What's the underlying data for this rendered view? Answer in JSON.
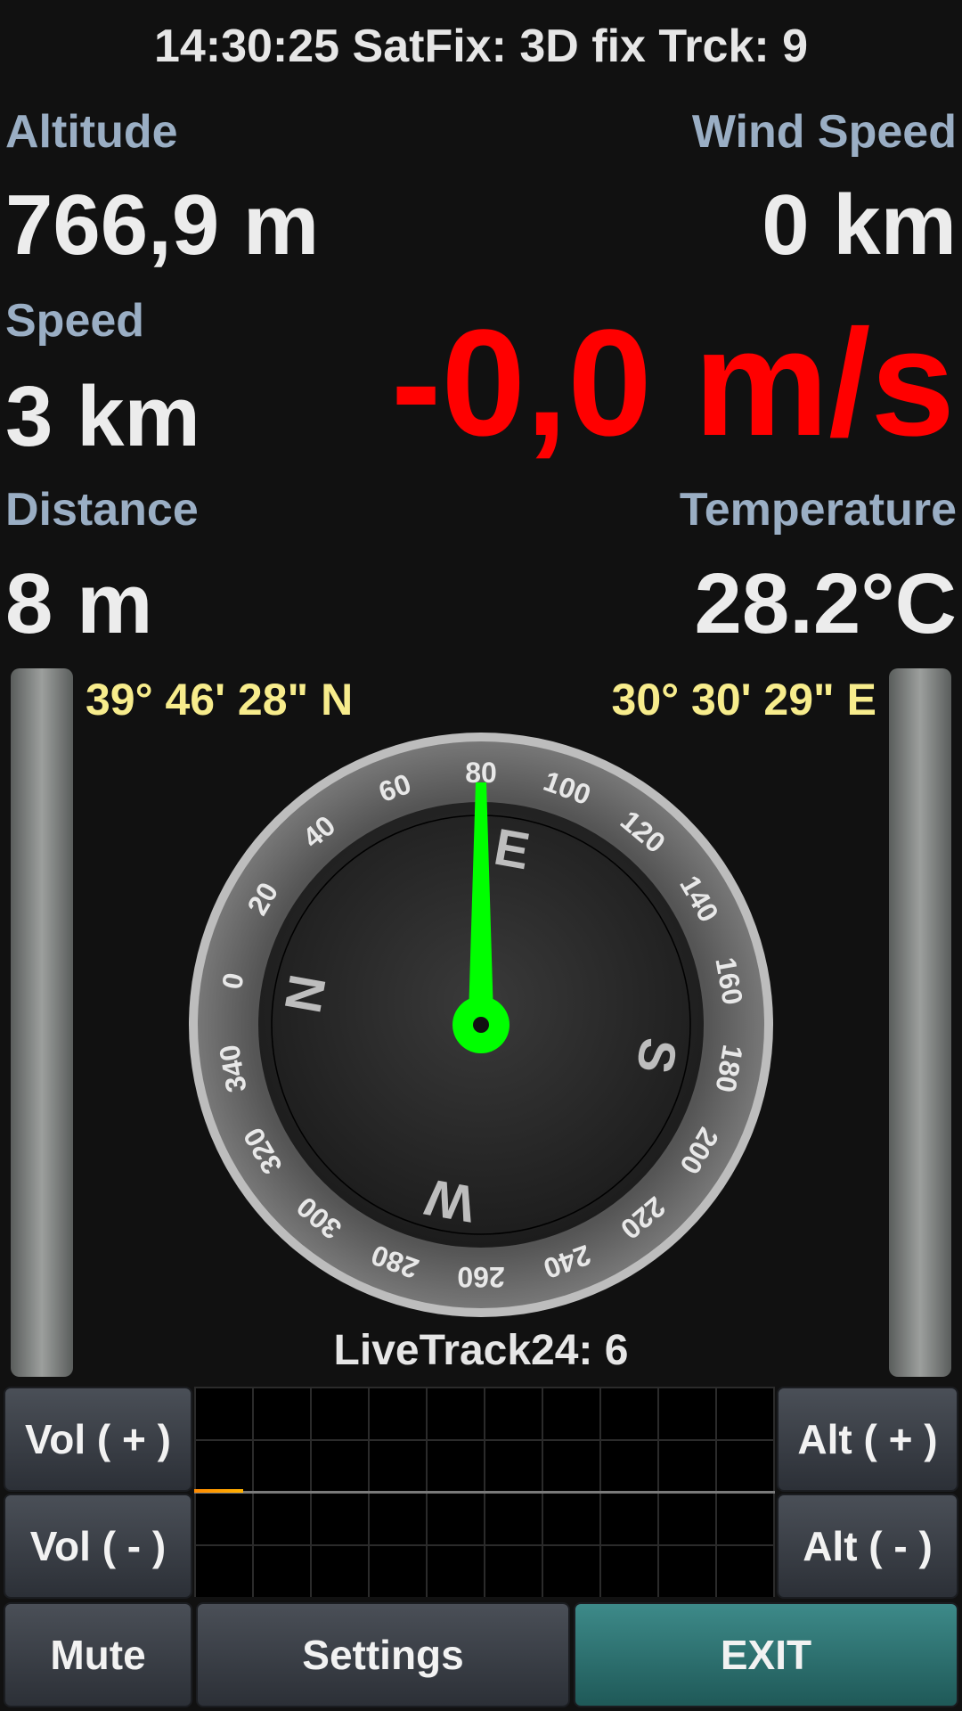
{
  "status": {
    "text": "14:30:25  SatFix: 3D fix  Trck: 9"
  },
  "altitude": {
    "label": "Altitude",
    "value": "766,9 m"
  },
  "wind_speed": {
    "label": "Wind Speed",
    "value": "0 km"
  },
  "speed": {
    "label": "Speed",
    "value": "3 km"
  },
  "vario": {
    "value": "-0,0 m/s"
  },
  "distance": {
    "label": "Distance",
    "value": "8 m"
  },
  "temperature": {
    "label": "Temperature",
    "value": "28.2°C"
  },
  "coords": {
    "lat": "39° 46' 28\" N",
    "lon": "30° 30' 29\" E"
  },
  "compass": {
    "heading_deg": 80,
    "ticks": [
      "0",
      "20",
      "40",
      "60",
      "80",
      "100",
      "120",
      "140",
      "160",
      "180",
      "200",
      "220",
      "240",
      "260",
      "280",
      "300",
      "320",
      "340"
    ],
    "cardinals": [
      "N",
      "E",
      "S",
      "W"
    ]
  },
  "livetrack": {
    "text": "LiveTrack24: 6"
  },
  "buttons": {
    "vol_up": "Vol ( + )",
    "vol_down": "Vol ( - )",
    "alt_up": "Alt ( + )",
    "alt_down": "Alt ( - )",
    "mute": "Mute",
    "settings": "Settings",
    "exit": "EXIT"
  },
  "colors": {
    "vario": "#ff0000",
    "needle": "#00ff00",
    "coords": "#f7ec8c",
    "labels": "#9aaec4"
  }
}
